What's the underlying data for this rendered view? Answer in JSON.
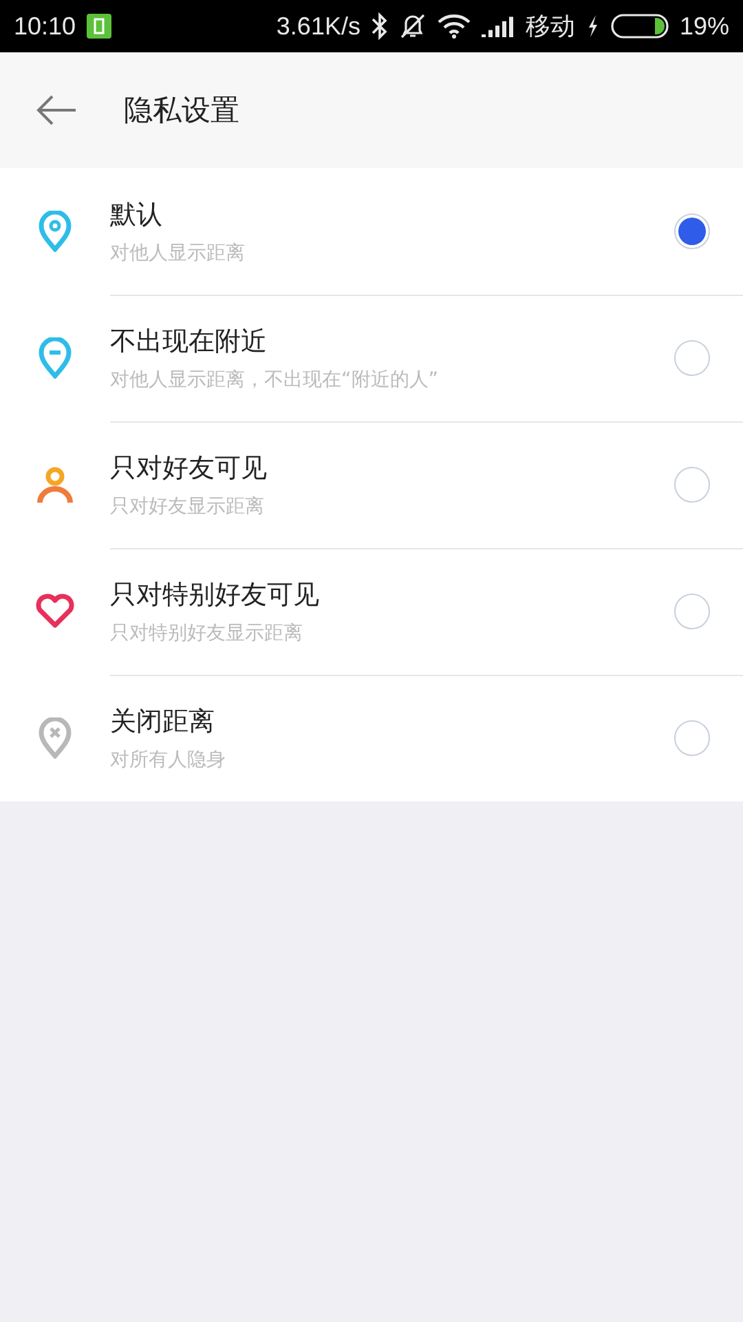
{
  "status_bar": {
    "time": "10:10",
    "speed": "3.61K/s",
    "carrier": "移动",
    "battery": "19%"
  },
  "header": {
    "title": "隐私设置"
  },
  "options": [
    {
      "kind": "pin-dot",
      "title": "默认",
      "subtitle": "对他人显示距离",
      "selected": true
    },
    {
      "kind": "pin-minus",
      "title": "不出现在附近",
      "subtitle": "对他人显示距离，不出现在“附近的人”",
      "selected": false
    },
    {
      "kind": "person",
      "title": "只对好友可见",
      "subtitle": "只对好友显示距离",
      "selected": false
    },
    {
      "kind": "heart",
      "title": "只对特别好友可见",
      "subtitle": "只对特别好友显示距离",
      "selected": false
    },
    {
      "kind": "pin-x",
      "title": "关闭距离",
      "subtitle": "对所有人隐身",
      "selected": false
    }
  ]
}
